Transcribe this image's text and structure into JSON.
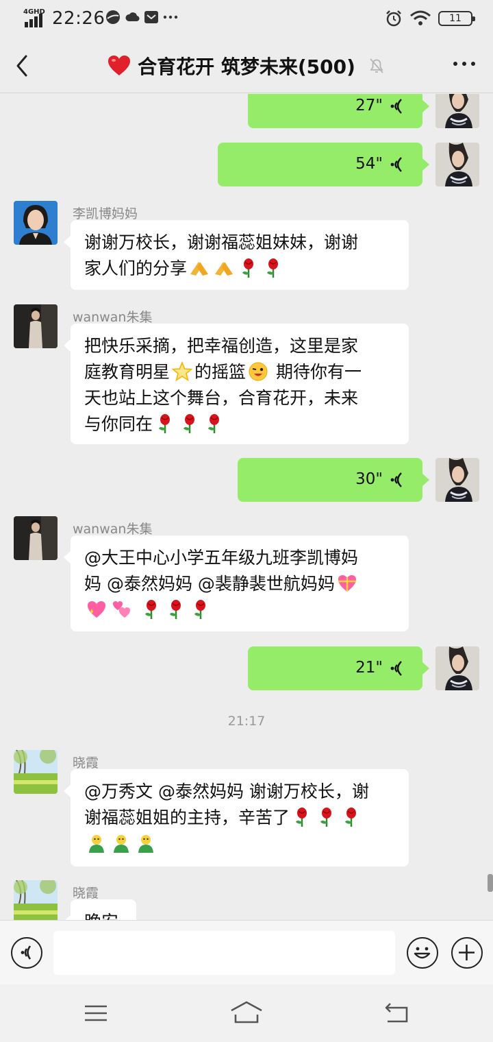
{
  "status_bar": {
    "network": "4GHD",
    "time": "22:26",
    "battery": "11"
  },
  "header": {
    "title": "合育花开 筑梦未来(500)",
    "icons": [
      "back-icon",
      "heart-icon",
      "mute-bell-icon",
      "more-icon"
    ]
  },
  "messages": {
    "m1": {
      "type": "voice-out",
      "duration": "27\""
    },
    "m2": {
      "type": "voice-out",
      "duration": "54\""
    },
    "m3": {
      "sender": "李凯博妈妈",
      "line1": "谢谢万校长，谢谢福蕊姐妹妹，谢谢",
      "line2": "家人们的分享"
    },
    "m4": {
      "sender": "wanwan朱集",
      "line1": "把快乐采摘，把幸福创造，这里是家",
      "line2a": "庭教育明星",
      "line2b": "的摇篮",
      "line2c": " 期待你有一",
      "line3": "天也站上这个舞台，合育花开，未来",
      "line4": "与你同在"
    },
    "m5": {
      "type": "voice-out",
      "duration": "30\""
    },
    "m6": {
      "sender": "wanwan朱集",
      "line1": "@大王中心小学五年级九班李凯博妈",
      "line2": "妈 @泰然妈妈 @裴静裴世航妈妈"
    },
    "m7": {
      "type": "voice-out",
      "duration": "21\""
    },
    "timestamp": "21:17",
    "m8": {
      "sender": "晓霞",
      "line1": "@万秀文 @泰然妈妈  谢谢万校长，谢",
      "line2": "谢福蕊姐姐的主持，辛苦了"
    },
    "m9": {
      "sender": "晓霞",
      "line1": "晚安"
    }
  },
  "colors": {
    "background": "#ededed",
    "outgoing_bubble": "#95ec69",
    "incoming_bubble": "#ffffff",
    "rose": "#d7141e"
  }
}
